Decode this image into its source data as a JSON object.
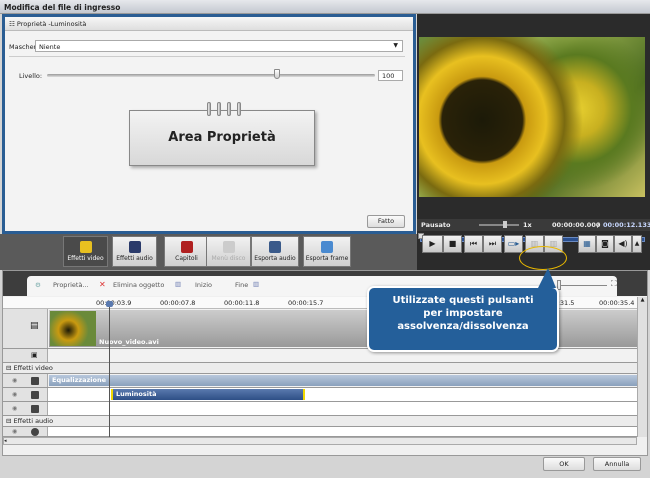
{
  "window": {
    "title": "Modifica del file di ingresso"
  },
  "properties": {
    "title": "Proprietà -Luminosità",
    "mask_label": "Maschera:",
    "mask_value": "Niente",
    "level_label": "Livello:",
    "level_value": "100",
    "level_fraction": 0.7,
    "area_label": "Area Proprietà",
    "done_button": "Fatto"
  },
  "player": {
    "status": "Pausato",
    "speed": "1x",
    "current_time": "00:00:00.000",
    "separator": "/",
    "total_time": "00:00:12.133"
  },
  "toolbar": [
    "Effetti video",
    "Effetti audio",
    "Capitoli",
    "Menù disco",
    "Esporta audio",
    "Esporta frame"
  ],
  "timeline": {
    "actions": [
      "Proprietà...",
      "Elimina oggetto",
      "Inizio",
      "Fine"
    ],
    "ruler": [
      "00:00:03.9",
      "00:00:07.8",
      "00:00:11.8",
      "00:00:15.7",
      "00:00:31.5",
      "00:00:35.4"
    ],
    "video_clip": "Nuovo_video.avi",
    "video_effects_label": "Effetti video",
    "effects": [
      "Equalizzazione",
      "Luminosità"
    ],
    "audio_effects_label": "Effetti audio"
  },
  "tooltip": {
    "line1": "Utilizzate questi pulsanti",
    "line2": "per impostare",
    "line3": "assolvenza/dissolvenza"
  },
  "buttons": {
    "ok": "OK",
    "cancel": "Annulla"
  },
  "colors": {
    "accent": "#245f9a",
    "highlight": "#e8b800"
  }
}
